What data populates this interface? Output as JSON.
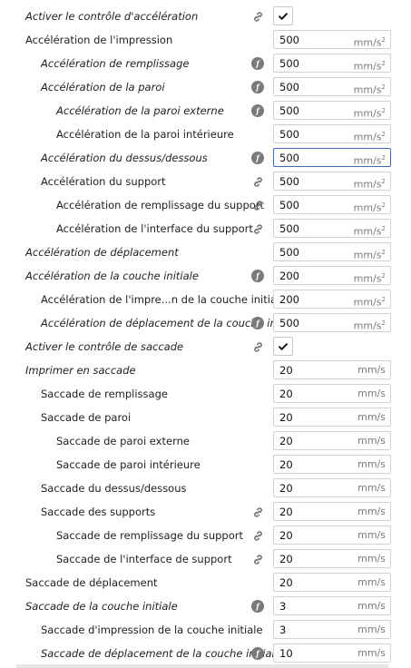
{
  "rows": [
    {
      "label": "Activer le contrôle d'accélération",
      "italic": true,
      "indent": 0,
      "icon": "link-icon",
      "type": "checkbox",
      "checked": true
    },
    {
      "label": "Accélération de l'impression",
      "italic": false,
      "indent": 0,
      "icon": "",
      "type": "field",
      "value": "500",
      "unit": "mm/s",
      "sup": "2"
    },
    {
      "label": "Accélération de remplissage",
      "italic": true,
      "indent": 1,
      "icon": "function-icon",
      "type": "field",
      "value": "500",
      "unit": "mm/s",
      "sup": "2"
    },
    {
      "label": "Accélération de la paroi",
      "italic": true,
      "indent": 1,
      "icon": "function-icon",
      "type": "field",
      "value": "500",
      "unit": "mm/s",
      "sup": "2"
    },
    {
      "label": "Accélération de la paroi externe",
      "italic": true,
      "indent": 2,
      "icon": "function-icon",
      "type": "field",
      "value": "500",
      "unit": "mm/s",
      "sup": "2"
    },
    {
      "label": "Accélération de la paroi intérieure",
      "italic": false,
      "indent": 2,
      "icon": "",
      "type": "field",
      "value": "500",
      "unit": "mm/s",
      "sup": "2"
    },
    {
      "label": "Accélération du dessus/dessous",
      "italic": true,
      "indent": 1,
      "icon": "function-icon",
      "type": "field",
      "value": "500",
      "unit": "mm/s",
      "sup": "2",
      "focused": true
    },
    {
      "label": "Accélération du support",
      "italic": false,
      "indent": 1,
      "icon": "link-icon",
      "type": "field",
      "value": "500",
      "unit": "mm/s",
      "sup": "2"
    },
    {
      "label": "Accélération de remplissage du support",
      "italic": false,
      "indent": 2,
      "icon": "link-icon",
      "type": "field",
      "value": "500",
      "unit": "mm/s",
      "sup": "2"
    },
    {
      "label": "Accélération de l'interface du support",
      "italic": false,
      "indent": 2,
      "icon": "link-icon",
      "type": "field",
      "value": "500",
      "unit": "mm/s",
      "sup": "2"
    },
    {
      "label": "Accélération de déplacement",
      "italic": true,
      "indent": 0,
      "icon": "",
      "type": "field",
      "value": "500",
      "unit": "mm/s",
      "sup": "2"
    },
    {
      "label": "Accélération de la couche initiale",
      "italic": true,
      "indent": 0,
      "icon": "function-icon",
      "type": "field",
      "value": "200",
      "unit": "mm/s",
      "sup": "2"
    },
    {
      "label": "Accélération de l'impre...n de la couche initiale",
      "italic": false,
      "indent": 1,
      "icon": "",
      "type": "field",
      "value": "200",
      "unit": "mm/s",
      "sup": "2"
    },
    {
      "label": "Accélération de déplacement de la couche initiale",
      "italic": true,
      "indent": 1,
      "icon": "function-icon",
      "type": "field",
      "value": "500",
      "unit": "mm/s",
      "sup": "2"
    },
    {
      "label": "Activer le contrôle de saccade",
      "italic": true,
      "indent": 0,
      "icon": "link-icon",
      "type": "checkbox",
      "checked": true
    },
    {
      "label": "Imprimer en saccade",
      "italic": true,
      "indent": 0,
      "icon": "",
      "type": "field",
      "value": "20",
      "unit": "mm/s",
      "sup": ""
    },
    {
      "label": "Saccade de remplissage",
      "italic": false,
      "indent": 1,
      "icon": "",
      "type": "field",
      "value": "20",
      "unit": "mm/s",
      "sup": ""
    },
    {
      "label": "Saccade de paroi",
      "italic": false,
      "indent": 1,
      "icon": "",
      "type": "field",
      "value": "20",
      "unit": "mm/s",
      "sup": ""
    },
    {
      "label": "Saccade de paroi externe",
      "italic": false,
      "indent": 2,
      "icon": "",
      "type": "field",
      "value": "20",
      "unit": "mm/s",
      "sup": ""
    },
    {
      "label": "Saccade de paroi intérieure",
      "italic": false,
      "indent": 2,
      "icon": "",
      "type": "field",
      "value": "20",
      "unit": "mm/s",
      "sup": ""
    },
    {
      "label": "Saccade du dessus/dessous",
      "italic": false,
      "indent": 1,
      "icon": "",
      "type": "field",
      "value": "20",
      "unit": "mm/s",
      "sup": ""
    },
    {
      "label": "Saccade des supports",
      "italic": false,
      "indent": 1,
      "icon": "link-icon",
      "type": "field",
      "value": "20",
      "unit": "mm/s",
      "sup": ""
    },
    {
      "label": "Saccade de remplissage du support",
      "italic": false,
      "indent": 2,
      "icon": "link-icon",
      "type": "field",
      "value": "20",
      "unit": "mm/s",
      "sup": ""
    },
    {
      "label": "Saccade de l'interface de support",
      "italic": false,
      "indent": 2,
      "icon": "link-icon",
      "type": "field",
      "value": "20",
      "unit": "mm/s",
      "sup": ""
    },
    {
      "label": "Saccade de déplacement",
      "italic": false,
      "indent": 0,
      "icon": "",
      "type": "field",
      "value": "20",
      "unit": "mm/s",
      "sup": ""
    },
    {
      "label": "Saccade de la couche initiale",
      "italic": true,
      "indent": 0,
      "icon": "function-icon",
      "type": "field",
      "value": "3",
      "unit": "mm/s",
      "sup": ""
    },
    {
      "label": "Saccade d'impression de la couche initiale",
      "italic": false,
      "indent": 1,
      "icon": "",
      "type": "field",
      "value": "3",
      "unit": "mm/s",
      "sup": ""
    },
    {
      "label": "Saccade de déplacement de la couche initiale",
      "italic": true,
      "indent": 1,
      "icon": "function-icon",
      "type": "field",
      "value": "10",
      "unit": "mm/s",
      "sup": ""
    }
  ],
  "function_icon_text": "f",
  "colors": {
    "focus_border": "#3b6ab8",
    "icon_gray": "#7a7a7a",
    "field_border": "#d2d2d2"
  }
}
